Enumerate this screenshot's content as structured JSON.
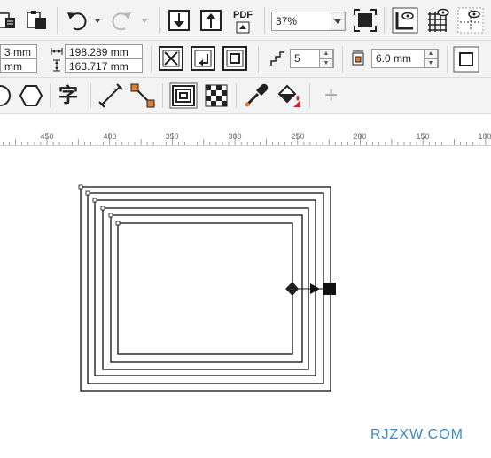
{
  "toolbar_top": {
    "zoom_value": "37%",
    "pdf_label": "PDF",
    "icons": [
      "paste-icon",
      "clipboard-icon",
      "undo-icon",
      "redo-icon",
      "import-icon",
      "export-icon",
      "publish-pdf-icon",
      "full-screen-icon",
      "rulers-icon",
      "grid-icon",
      "guidelines-icon"
    ]
  },
  "property_bar": {
    "x_value": "3 mm",
    "y_value": "mm",
    "width_value": "198.289 mm",
    "height_value": "163.717 mm",
    "steps_value": "5",
    "offset_value": "6.0 mm",
    "icons": [
      "to-center-icon",
      "inside-icon",
      "outside-icon",
      "steps-icon",
      "offset-icon",
      "outline-only-icon"
    ]
  },
  "toolbox": {
    "text_tool_glyph": "字",
    "add_label": "+",
    "icons": [
      "ellipse-tool-icon",
      "polygon-tool-icon",
      "text-tool-icon",
      "parallel-dimension-icon",
      "connector-icon",
      "contour-tool-icon",
      "transparency-tool-icon",
      "eyedropper-icon",
      "interactive-fill-icon",
      "add-tool-icon"
    ]
  },
  "ruler": {
    "labels": [
      "450",
      "400",
      "350",
      "300",
      "250",
      "200",
      "150",
      "100"
    ]
  },
  "canvas": {
    "contour_steps": 5
  },
  "watermark": "RJZXW.COM"
}
